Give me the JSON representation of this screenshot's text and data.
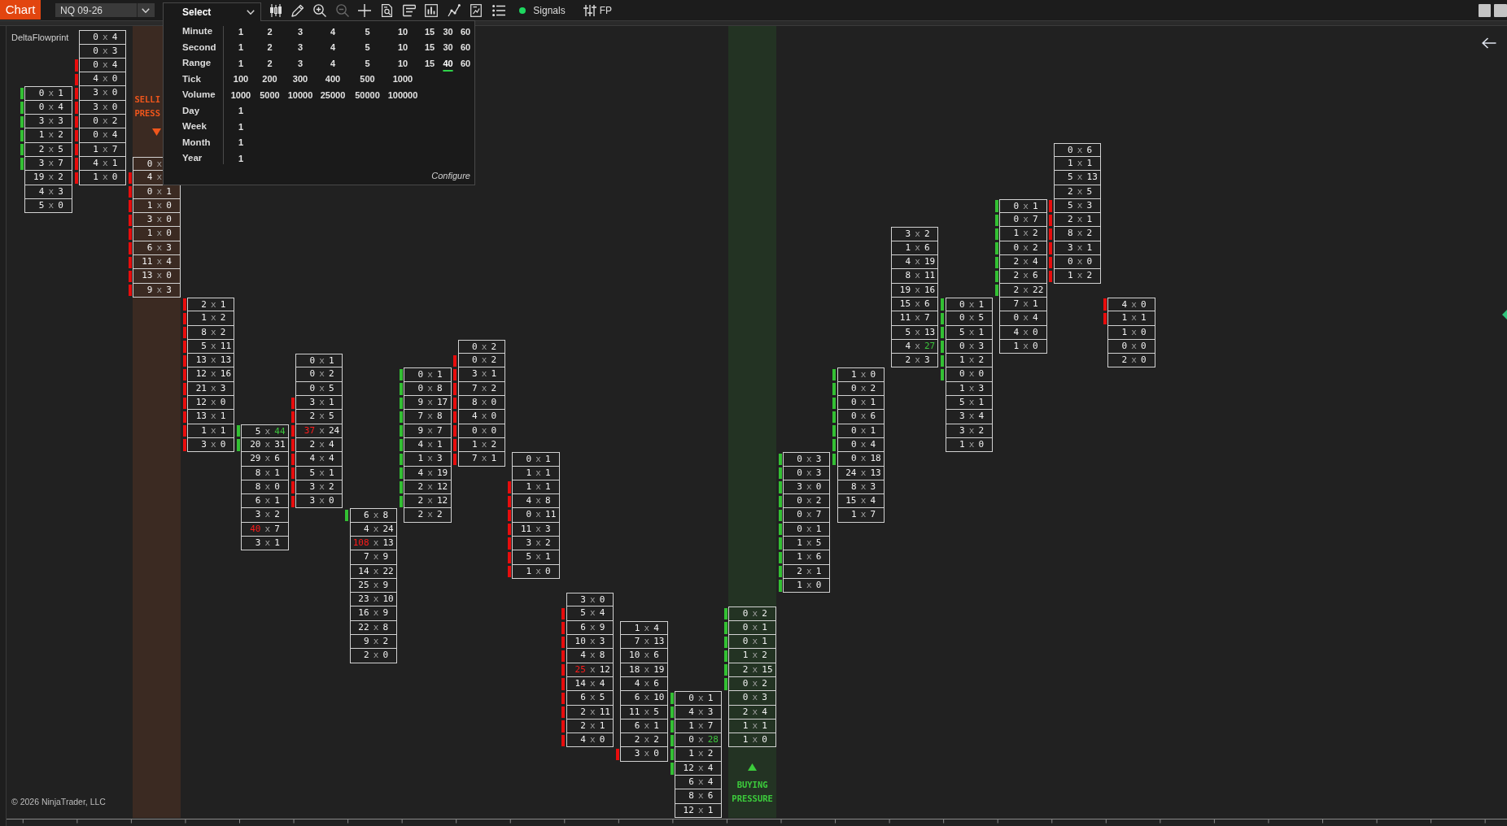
{
  "toolbar": {
    "app_button": "Chart",
    "instrument": "NQ 09-26",
    "period": {
      "label": "Select",
      "expanded": true
    },
    "tools": [
      {
        "kind": "candlestick",
        "disabled": false
      },
      {
        "kind": "pencil",
        "disabled": false
      },
      {
        "kind": "zoomin",
        "disabled": false
      },
      {
        "kind": "zoomout",
        "disabled": true
      },
      {
        "kind": "crosshair",
        "disabled": false
      },
      {
        "kind": "docsearch",
        "disabled": false
      },
      {
        "kind": "panel",
        "disabled": false
      },
      {
        "kind": "barchart",
        "disabled": false
      },
      {
        "kind": "linechart",
        "disabled": false
      },
      {
        "kind": "docchart",
        "disabled": false
      },
      {
        "kind": "list",
        "disabled": false
      }
    ],
    "signals": {
      "label": "Signals",
      "on": true
    },
    "fp": {
      "label": "FP"
    }
  },
  "period_menu": {
    "rows": [
      {
        "label": "Minute",
        "options": [
          {
            "label": "1",
            "selected": false
          },
          {
            "label": "2",
            "selected": false
          },
          {
            "label": "3",
            "selected": false
          },
          {
            "label": "4",
            "selected": false
          },
          {
            "label": "5",
            "selected": false
          },
          {
            "label": "10",
            "selected": false
          },
          {
            "label": "15",
            "selected": false
          },
          {
            "label": "30",
            "selected": false
          },
          {
            "label": "60",
            "selected": false
          }
        ]
      },
      {
        "label": "Second",
        "options": [
          {
            "label": "1",
            "selected": false
          },
          {
            "label": "2",
            "selected": false
          },
          {
            "label": "3",
            "selected": false
          },
          {
            "label": "4",
            "selected": false
          },
          {
            "label": "5",
            "selected": false
          },
          {
            "label": "10",
            "selected": false
          },
          {
            "label": "15",
            "selected": false
          },
          {
            "label": "30",
            "selected": false
          },
          {
            "label": "60",
            "selected": false
          }
        ]
      },
      {
        "label": "Range",
        "options": [
          {
            "label": "1",
            "selected": false
          },
          {
            "label": "2",
            "selected": false
          },
          {
            "label": "3",
            "selected": false
          },
          {
            "label": "4",
            "selected": false
          },
          {
            "label": "5",
            "selected": false
          },
          {
            "label": "10",
            "selected": false
          },
          {
            "label": "15",
            "selected": false
          },
          {
            "label": "40",
            "selected": true
          },
          {
            "label": "60",
            "selected": false
          }
        ]
      },
      {
        "label": "Tick",
        "options": [
          {
            "label": "100",
            "selected": false
          },
          {
            "label": "200",
            "selected": false
          },
          {
            "label": "300",
            "selected": false
          },
          {
            "label": "400",
            "selected": false
          },
          {
            "label": "500",
            "selected": false
          },
          {
            "label": "1000",
            "selected": false
          }
        ]
      },
      {
        "label": "Volume",
        "options": [
          {
            "label": "1000",
            "selected": false
          },
          {
            "label": "5000",
            "selected": false
          },
          {
            "label": "10000",
            "selected": false
          },
          {
            "label": "25000",
            "selected": false
          },
          {
            "label": "50000",
            "selected": false
          },
          {
            "label": "100000",
            "selected": false
          }
        ]
      },
      {
        "label": "Day",
        "options": [
          {
            "label": "1",
            "selected": false
          }
        ]
      },
      {
        "label": "Week",
        "options": [
          {
            "label": "1",
            "selected": false
          }
        ]
      },
      {
        "label": "Month",
        "options": [
          {
            "label": "1",
            "selected": false
          }
        ]
      },
      {
        "label": "Year",
        "options": [
          {
            "label": "1",
            "selected": false
          }
        ]
      }
    ],
    "configure": "Configure"
  },
  "chart": {
    "indicator": "DeltaFlowprint",
    "bars": [
      {
        "cells": [
          {
            "text": "0 x 1",
            "kind": "plain",
            "marker": {
              "color": "#33c033"
            }
          },
          {
            "text": "0 x 4",
            "kind": "plain",
            "marker": {
              "color": "#33c033"
            }
          },
          {
            "text": "3 x 3",
            "kind": "plain",
            "marker": {
              "color": "#33c033"
            }
          },
          {
            "text": "1 x 2",
            "kind": "plain",
            "marker": {
              "color": "#33c033"
            }
          },
          {
            "text": "2 x 5",
            "kind": "plain",
            "marker": {
              "color": "#33c033"
            }
          },
          {
            "text": "3 x 7",
            "kind": "plain",
            "marker": {
              "color": "#33c033"
            }
          },
          {
            "text": "19 x 2",
            "kind": "plain"
          },
          {
            "text": "4 x 3",
            "kind": "plain"
          },
          {
            "text": "5 x 0",
            "kind": "plain"
          }
        ]
      },
      {
        "cells": [
          {
            "text": "0 x 4",
            "kind": "plain"
          },
          {
            "text": "0 x 3",
            "kind": "plain"
          },
          {
            "text": "0 x 4",
            "kind": "plain",
            "marker": {
              "color": "#e80c0c"
            }
          },
          {
            "text": "4 x 0",
            "kind": "plain",
            "marker": {
              "color": "#e80c0c"
            }
          },
          {
            "text": "3 x 0",
            "kind": "plain",
            "marker": {
              "color": "#e80c0c"
            }
          },
          {
            "text": "3 x 0",
            "kind": "plain",
            "marker": {
              "color": "#e80c0c"
            }
          },
          {
            "text": "0 x 2",
            "kind": "plain",
            "marker": {
              "color": "#e80c0c"
            }
          },
          {
            "text": "0 x 4",
            "kind": "plain",
            "marker": {
              "color": "#e80c0c"
            }
          },
          {
            "text": "1 x 7",
            "kind": "plain",
            "marker": {
              "color": "#e80c0c"
            }
          },
          {
            "text": "4 x 1",
            "kind": "plain",
            "marker": {
              "color": "#e80c0c"
            }
          },
          {
            "text": "1 x 0",
            "kind": "plain",
            "marker": {
              "color": "#e80c0c"
            }
          }
        ]
      },
      {
        "zone": {
          "kind": "selling",
          "label": "SELLI PRESS"
        },
        "cells": [
          {
            "text": "0 x",
            "kind": "plain"
          },
          {
            "text": "4 x",
            "kind": "plain",
            "marker": {
              "color": "#e80c0c"
            }
          },
          {
            "text": "0 x 1",
            "kind": "plain",
            "marker": {
              "color": "#e80c0c"
            }
          },
          {
            "text": "1 x 0",
            "kind": "plain",
            "marker": {
              "color": "#e80c0c"
            }
          },
          {
            "text": "3 x 0",
            "kind": "plain",
            "marker": {
              "color": "#e80c0c"
            }
          },
          {
            "text": "1 x 0",
            "kind": "plain",
            "marker": {
              "color": "#e80c0c"
            }
          },
          {
            "text": "6 x 3",
            "kind": "plain",
            "marker": {
              "color": "#e80c0c"
            }
          },
          {
            "text": "11 x 4",
            "kind": "plain",
            "marker": {
              "color": "#e80c0c"
            }
          },
          {
            "text": "13 x 0",
            "kind": "plain",
            "marker": {
              "color": "#e80c0c"
            }
          },
          {
            "text": "9 x 3",
            "kind": "plain",
            "marker": {
              "color": "#e80c0c"
            }
          }
        ]
      },
      {
        "cells": [
          {
            "text": "2 x 1",
            "kind": "plain",
            "marker": {
              "color": "#e80c0c"
            }
          },
          {
            "text": "1 x 2",
            "kind": "plain",
            "marker": {
              "color": "#e80c0c"
            }
          },
          {
            "text": "8 x 2",
            "kind": "plain",
            "marker": {
              "color": "#e80c0c"
            }
          },
          {
            "text": "5 x 11",
            "kind": "plain",
            "marker": {
              "color": "#e80c0c"
            }
          },
          {
            "text": "13 x 13",
            "kind": "plain",
            "marker": {
              "color": "#e80c0c"
            }
          },
          {
            "text": "12 x 16",
            "kind": "plain",
            "marker": {
              "color": "#e80c0c"
            }
          },
          {
            "text": "21 x 3",
            "kind": "plain",
            "marker": {
              "color": "#e80c0c"
            }
          },
          {
            "text": "12 x 0",
            "kind": "plain",
            "marker": {
              "color": "#e80c0c"
            }
          },
          {
            "text": "13 x 1",
            "kind": "plain",
            "marker": {
              "color": "#e80c0c"
            }
          },
          {
            "text": "1 x 1",
            "kind": "plain",
            "marker": {
              "color": "#e80c0c"
            }
          },
          {
            "text": "3 x 0",
            "kind": "plain",
            "marker": {
              "color": "#e80c0c"
            }
          }
        ]
      },
      {
        "cells": [
          {
            "text": "5 x 44",
            "kind": "askheavy",
            "marker": {
              "color": "#33c033"
            }
          },
          {
            "text": "20 x 31",
            "kind": "plain",
            "marker": {
              "color": "#33c033"
            }
          },
          {
            "text": "29 x 6",
            "kind": "plain"
          },
          {
            "text": "8 x 1",
            "kind": "plain"
          },
          {
            "text": "8 x 0",
            "kind": "plain"
          },
          {
            "text": "6 x 1",
            "kind": "plain"
          },
          {
            "text": "3 x 2",
            "kind": "plain"
          },
          {
            "text": "40 x 7",
            "kind": "bidheavy"
          },
          {
            "text": "3 x 1",
            "kind": "plain"
          }
        ]
      },
      {
        "cells": [
          {
            "text": "0 x 1",
            "kind": "plain"
          },
          {
            "text": "0 x 2",
            "kind": "plain"
          },
          {
            "text": "0 x 5",
            "kind": "plain"
          },
          {
            "text": "3 x 1",
            "kind": "plain",
            "marker": {
              "color": "#e80c0c"
            }
          },
          {
            "text": "2 x 5",
            "kind": "plain",
            "marker": {
              "color": "#e80c0c"
            }
          },
          {
            "text": "37 x 24",
            "kind": "bidheavy",
            "marker": {
              "color": "#e80c0c"
            }
          },
          {
            "text": "2 x 4",
            "kind": "plain",
            "marker": {
              "color": "#e80c0c"
            }
          },
          {
            "text": "4 x 4",
            "kind": "plain",
            "marker": {
              "color": "#e80c0c"
            }
          },
          {
            "text": "5 x 1",
            "kind": "plain",
            "marker": {
              "color": "#e80c0c"
            }
          },
          {
            "text": "3 x 2",
            "kind": "plain",
            "marker": {
              "color": "#e80c0c"
            }
          },
          {
            "text": "3 x 0",
            "kind": "plain",
            "marker": {
              "color": "#e80c0c"
            }
          }
        ]
      },
      {
        "cells": [
          {
            "text": "6 x 8",
            "kind": "plain",
            "marker": {
              "color": "#33c033"
            }
          },
          {
            "text": "4 x 24",
            "kind": "plain"
          },
          {
            "text": "108 x 13",
            "kind": "bidheavy"
          },
          {
            "text": "7 x 9",
            "kind": "plain"
          },
          {
            "text": "14 x 22",
            "kind": "plain"
          },
          {
            "text": "25 x 9",
            "kind": "plain"
          },
          {
            "text": "23 x 10",
            "kind": "plain"
          },
          {
            "text": "16 x 9",
            "kind": "plain"
          },
          {
            "text": "22 x 8",
            "kind": "plain"
          },
          {
            "text": "9 x 2",
            "kind": "plain"
          },
          {
            "text": "2 x 0",
            "kind": "plain"
          }
        ]
      },
      {
        "cells": [
          {
            "text": "0 x 1",
            "kind": "plain",
            "marker": {
              "color": "#33c033"
            }
          },
          {
            "text": "0 x 8",
            "kind": "plain",
            "marker": {
              "color": "#33c033"
            }
          },
          {
            "text": "9 x 17",
            "kind": "plain",
            "marker": {
              "color": "#33c033"
            }
          },
          {
            "text": "7 x 8",
            "kind": "plain",
            "marker": {
              "color": "#33c033"
            }
          },
          {
            "text": "9 x 7",
            "kind": "plain",
            "marker": {
              "color": "#33c033"
            }
          },
          {
            "text": "4 x 1",
            "kind": "plain",
            "marker": {
              "color": "#33c033"
            }
          },
          {
            "text": "1 x 3",
            "kind": "plain",
            "marker": {
              "color": "#33c033"
            }
          },
          {
            "text": "4 x 19",
            "kind": "plain",
            "marker": {
              "color": "#33c033"
            }
          },
          {
            "text": "2 x 12",
            "kind": "plain",
            "marker": {
              "color": "#33c033"
            }
          },
          {
            "text": "2 x 12",
            "kind": "plain",
            "marker": {
              "color": "#33c033"
            }
          },
          {
            "text": "2 x 2",
            "kind": "plain"
          }
        ]
      },
      {
        "cells": [
          {
            "text": "0 x 2",
            "kind": "plain"
          },
          {
            "text": "0 x 2",
            "kind": "plain",
            "marker": {
              "color": "#e80c0c"
            }
          },
          {
            "text": "3 x 1",
            "kind": "plain",
            "marker": {
              "color": "#e80c0c"
            }
          },
          {
            "text": "7 x 2",
            "kind": "plain",
            "marker": {
              "color": "#e80c0c"
            }
          },
          {
            "text": "8 x 0",
            "kind": "plain",
            "marker": {
              "color": "#e80c0c"
            }
          },
          {
            "text": "4 x 0",
            "kind": "plain",
            "marker": {
              "color": "#e80c0c"
            }
          },
          {
            "text": "0 x 0",
            "kind": "plain",
            "marker": {
              "color": "#e80c0c"
            }
          },
          {
            "text": "1 x 2",
            "kind": "plain",
            "marker": {
              "color": "#e80c0c"
            }
          },
          {
            "text": "7 x 1",
            "kind": "plain",
            "marker": {
              "color": "#e80c0c"
            }
          }
        ]
      },
      {
        "cells": [
          {
            "text": "0 x 1",
            "kind": "plain"
          },
          {
            "text": "1 x 1",
            "kind": "plain"
          },
          {
            "text": "1 x 1",
            "kind": "plain",
            "marker": {
              "color": "#e80c0c"
            }
          },
          {
            "text": "4 x 8",
            "kind": "plain",
            "marker": {
              "color": "#e80c0c"
            }
          },
          {
            "text": "0 x 11",
            "kind": "plain",
            "marker": {
              "color": "#e80c0c"
            }
          },
          {
            "text": "11 x 3",
            "kind": "plain",
            "marker": {
              "color": "#e80c0c"
            }
          },
          {
            "text": "3 x 2",
            "kind": "plain",
            "marker": {
              "color": "#e80c0c"
            }
          },
          {
            "text": "5 x 1",
            "kind": "plain",
            "marker": {
              "color": "#e80c0c"
            }
          },
          {
            "text": "1 x 0",
            "kind": "plain",
            "marker": {
              "color": "#e80c0c"
            }
          }
        ]
      },
      {
        "cells": [
          {
            "text": "3 x 0",
            "kind": "plain"
          },
          {
            "text": "5 x 4",
            "kind": "plain",
            "marker": {
              "color": "#e80c0c"
            }
          },
          {
            "text": "6 x 9",
            "kind": "plain",
            "marker": {
              "color": "#e80c0c"
            }
          },
          {
            "text": "10 x 3",
            "kind": "plain",
            "marker": {
              "color": "#e80c0c"
            }
          },
          {
            "text": "4 x 8",
            "kind": "plain",
            "marker": {
              "color": "#e80c0c"
            }
          },
          {
            "text": "25 x 12",
            "kind": "bidheavy",
            "marker": {
              "color": "#e80c0c"
            }
          },
          {
            "text": "14 x 4",
            "kind": "plain",
            "marker": {
              "color": "#e80c0c"
            }
          },
          {
            "text": "6 x 5",
            "kind": "plain",
            "marker": {
              "color": "#e80c0c"
            }
          },
          {
            "text": "2 x 11",
            "kind": "plain",
            "marker": {
              "color": "#e80c0c"
            }
          },
          {
            "text": "2 x 1",
            "kind": "plain",
            "marker": {
              "color": "#e80c0c"
            }
          },
          {
            "text": "4 x 0",
            "kind": "plain",
            "marker": {
              "color": "#e80c0c"
            }
          }
        ]
      },
      {
        "cells": [
          {
            "text": "1 x 4",
            "kind": "plain"
          },
          {
            "text": "7 x 13",
            "kind": "plain"
          },
          {
            "text": "10 x 6",
            "kind": "plain"
          },
          {
            "text": "18 x 19",
            "kind": "plain"
          },
          {
            "text": "4 x 6",
            "kind": "plain"
          },
          {
            "text": "6 x 10",
            "kind": "plain"
          },
          {
            "text": "11 x 5",
            "kind": "plain"
          },
          {
            "text": "6 x 1",
            "kind": "plain"
          },
          {
            "text": "2 x 2",
            "kind": "plain"
          },
          {
            "text": "3 x 0",
            "kind": "plain",
            "marker": {
              "color": "#e80c0c"
            }
          }
        ]
      },
      {
        "cells": [
          {
            "text": "0 x 1",
            "kind": "plain",
            "marker": {
              "color": "#33c033"
            }
          },
          {
            "text": "4 x 3",
            "kind": "plain",
            "marker": {
              "color": "#33c033"
            }
          },
          {
            "text": "1 x 7",
            "kind": "plain",
            "marker": {
              "color": "#33c033"
            }
          },
          {
            "text": "0 x 28",
            "kind": "askheavy",
            "marker": {
              "color": "#33c033"
            }
          },
          {
            "text": "1 x 2",
            "kind": "plain",
            "marker": {
              "color": "#33c033"
            }
          },
          {
            "text": "12 x 4",
            "kind": "plain",
            "marker": {
              "color": "#33c033"
            }
          },
          {
            "text": "6 x 4",
            "kind": "plain"
          },
          {
            "text": "8 x 6",
            "kind": "plain"
          },
          {
            "text": "12 x 1",
            "kind": "plain"
          }
        ]
      },
      {
        "zone": {
          "kind": "buying",
          "label": "BUYING PRESSURE"
        },
        "cells": [
          {
            "text": "0 x 2",
            "kind": "plain",
            "marker": {
              "color": "#33c033"
            }
          },
          {
            "text": "0 x 1",
            "kind": "plain",
            "marker": {
              "color": "#33c033"
            }
          },
          {
            "text": "0 x 1",
            "kind": "plain",
            "marker": {
              "color": "#33c033"
            }
          },
          {
            "text": "1 x 2",
            "kind": "plain",
            "marker": {
              "color": "#33c033"
            }
          },
          {
            "text": "2 x 15",
            "kind": "plain",
            "marker": {
              "color": "#33c033"
            }
          },
          {
            "text": "0 x 2",
            "kind": "plain",
            "marker": {
              "color": "#33c033"
            }
          },
          {
            "text": "0 x 3",
            "kind": "plain"
          },
          {
            "text": "2 x 4",
            "kind": "plain"
          },
          {
            "text": "1 x 1",
            "kind": "plain"
          },
          {
            "text": "1 x 0",
            "kind": "plain"
          }
        ]
      },
      {
        "cells": [
          {
            "text": "0 x 3",
            "kind": "plain",
            "marker": {
              "color": "#33c033"
            }
          },
          {
            "text": "0 x 3",
            "kind": "plain",
            "marker": {
              "color": "#33c033"
            }
          },
          {
            "text": "3 x 0",
            "kind": "plain",
            "marker": {
              "color": "#33c033"
            }
          },
          {
            "text": "0 x 2",
            "kind": "plain",
            "marker": {
              "color": "#33c033"
            }
          },
          {
            "text": "0 x 7",
            "kind": "plain",
            "marker": {
              "color": "#33c033"
            }
          },
          {
            "text": "0 x 1",
            "kind": "plain",
            "marker": {
              "color": "#33c033"
            }
          },
          {
            "text": "1 x 5",
            "kind": "plain",
            "marker": {
              "color": "#33c033"
            }
          },
          {
            "text": "1 x 6",
            "kind": "plain",
            "marker": {
              "color": "#33c033"
            }
          },
          {
            "text": "2 x 1",
            "kind": "plain",
            "marker": {
              "color": "#33c033"
            }
          },
          {
            "text": "1 x 0",
            "kind": "plain",
            "marker": {
              "color": "#33c033"
            }
          }
        ]
      },
      {
        "cells": [
          {
            "text": "1 x 0",
            "kind": "plain",
            "marker": {
              "color": "#33c033"
            }
          },
          {
            "text": "0 x 2",
            "kind": "plain",
            "marker": {
              "color": "#33c033"
            }
          },
          {
            "text": "0 x 1",
            "kind": "plain",
            "marker": {
              "color": "#33c033"
            }
          },
          {
            "text": "0 x 6",
            "kind": "plain",
            "marker": {
              "color": "#33c033"
            }
          },
          {
            "text": "0 x 1",
            "kind": "plain",
            "marker": {
              "color": "#33c033"
            }
          },
          {
            "text": "0 x 4",
            "kind": "plain",
            "marker": {
              "color": "#33c033"
            }
          },
          {
            "text": "0 x 18",
            "kind": "plain",
            "marker": {
              "color": "#33c033"
            }
          },
          {
            "text": "24 x 13",
            "kind": "plain"
          },
          {
            "text": "8 x 3",
            "kind": "plain"
          },
          {
            "text": "15 x 4",
            "kind": "plain"
          },
          {
            "text": "1 x 7",
            "kind": "plain"
          }
        ]
      },
      {
        "cells": [
          {
            "text": "3 x 2",
            "kind": "plain"
          },
          {
            "text": "1 x 6",
            "kind": "plain"
          },
          {
            "text": "4 x 19",
            "kind": "plain"
          },
          {
            "text": "8 x 11",
            "kind": "plain"
          },
          {
            "text": "19 x 16",
            "kind": "plain"
          },
          {
            "text": "15 x 6",
            "kind": "plain"
          },
          {
            "text": "11 x 7",
            "kind": "plain"
          },
          {
            "text": "5 x 13",
            "kind": "plain"
          },
          {
            "text": "4 x 27",
            "kind": "askheavy"
          },
          {
            "text": "2 x 3",
            "kind": "plain"
          }
        ]
      },
      {
        "cells": [
          {
            "text": "0 x 1",
            "kind": "plain",
            "marker": {
              "color": "#33c033"
            }
          },
          {
            "text": "0 x 5",
            "kind": "plain",
            "marker": {
              "color": "#33c033"
            }
          },
          {
            "text": "5 x 1",
            "kind": "plain",
            "marker": {
              "color": "#33c033"
            }
          },
          {
            "text": "0 x 3",
            "kind": "plain",
            "marker": {
              "color": "#33c033"
            }
          },
          {
            "text": "1 x 2",
            "kind": "plain",
            "marker": {
              "color": "#33c033"
            }
          },
          {
            "text": "0 x 0",
            "kind": "plain",
            "marker": {
              "color": "#33c033"
            }
          },
          {
            "text": "1 x 3",
            "kind": "plain"
          },
          {
            "text": "5 x 1",
            "kind": "plain"
          },
          {
            "text": "3 x 4",
            "kind": "plain"
          },
          {
            "text": "3 x 2",
            "kind": "plain"
          },
          {
            "text": "1 x 0",
            "kind": "plain"
          }
        ]
      },
      {
        "cells": [
          {
            "text": "0 x 1",
            "kind": "plain",
            "marker": {
              "color": "#33c033"
            }
          },
          {
            "text": "0 x 7",
            "kind": "plain",
            "marker": {
              "color": "#33c033"
            }
          },
          {
            "text": "1 x 2",
            "kind": "plain",
            "marker": {
              "color": "#33c033"
            }
          },
          {
            "text": "0 x 2",
            "kind": "plain",
            "marker": {
              "color": "#33c033"
            }
          },
          {
            "text": "2 x 4",
            "kind": "plain",
            "marker": {
              "color": "#33c033"
            }
          },
          {
            "text": "2 x 6",
            "kind": "plain",
            "marker": {
              "color": "#33c033"
            }
          },
          {
            "text": "2 x 22",
            "kind": "plain",
            "marker": {
              "color": "#33c033"
            }
          },
          {
            "text": "7 x 1",
            "kind": "plain"
          },
          {
            "text": "0 x 4",
            "kind": "plain"
          },
          {
            "text": "4 x 0",
            "kind": "plain"
          },
          {
            "text": "1 x 0",
            "kind": "plain"
          }
        ]
      },
      {
        "cells": [
          {
            "text": "0 x 6",
            "kind": "plain"
          },
          {
            "text": "1 x 1",
            "kind": "plain"
          },
          {
            "text": "5 x 13",
            "kind": "plain"
          },
          {
            "text": "2 x 5",
            "kind": "plain"
          },
          {
            "text": "5 x 3",
            "kind": "plain",
            "marker": {
              "color": "#e80c0c"
            }
          },
          {
            "text": "2 x 1",
            "kind": "plain",
            "marker": {
              "color": "#e80c0c"
            }
          },
          {
            "text": "8 x 2",
            "kind": "plain",
            "marker": {
              "color": "#e80c0c"
            }
          },
          {
            "text": "3 x 1",
            "kind": "plain",
            "marker": {
              "color": "#e80c0c"
            }
          },
          {
            "text": "0 x 0",
            "kind": "plain",
            "marker": {
              "color": "#e80c0c"
            }
          },
          {
            "text": "1 x 2",
            "kind": "plain",
            "marker": {
              "color": "#e80c0c"
            }
          }
        ]
      },
      {
        "cells": [
          {
            "text": "4 x 0",
            "kind": "plain",
            "marker": {
              "color": "#e80c0c"
            }
          },
          {
            "text": "1 x 1",
            "kind": "plain",
            "marker": {
              "color": "#e80c0c"
            }
          },
          {
            "text": "1 x 0",
            "kind": "plain"
          },
          {
            "text": "0 x 0",
            "kind": "plain"
          },
          {
            "text": "2 x 0",
            "kind": "plain"
          }
        ]
      }
    ],
    "copyright": "© 2026 NinjaTrader, LLC"
  }
}
